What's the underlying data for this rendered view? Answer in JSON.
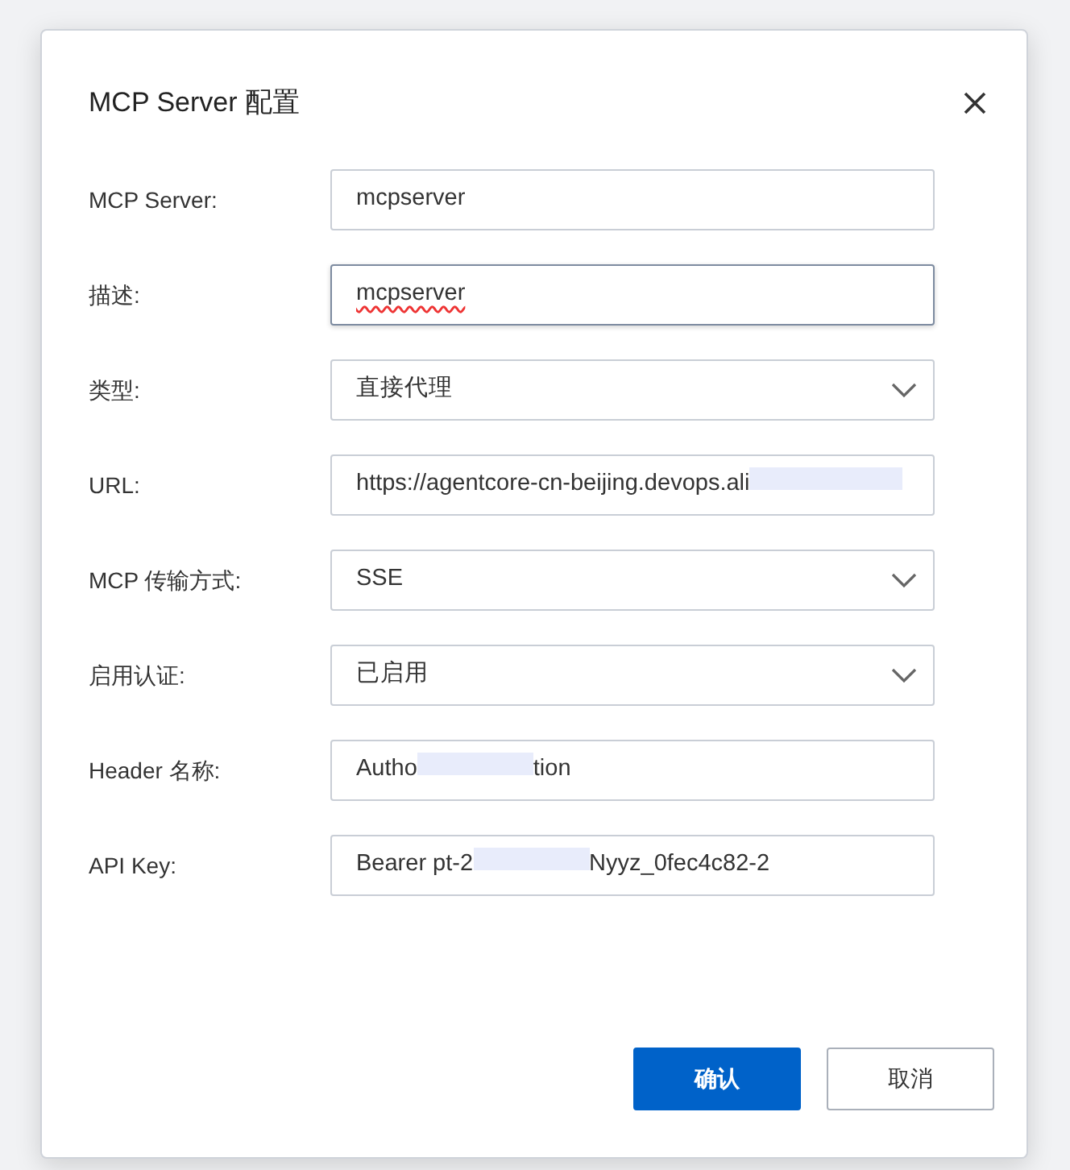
{
  "dialog": {
    "title": "MCP Server 配置",
    "fields": [
      {
        "label": "MCP Server:",
        "kind": "input",
        "value_parts": [
          "mcpserver"
        ],
        "focused": false,
        "misspelled": false
      },
      {
        "label": "描述:",
        "kind": "input",
        "value_parts": [
          "mcpserver"
        ],
        "focused": true,
        "misspelled": true
      },
      {
        "label": "类型:",
        "kind": "select",
        "value_parts": [
          "直接代理"
        ],
        "focused": false,
        "misspelled": false
      },
      {
        "label": "URL:",
        "kind": "input",
        "value_parts": [
          "https://agentcore-cn-beijing.devops.ali"
        ],
        "redacted_tail": true,
        "focused": false,
        "misspelled": false
      },
      {
        "label": "MCP 传输方式:",
        "kind": "select",
        "value_parts": [
          "SSE"
        ],
        "focused": false,
        "misspelled": false
      },
      {
        "label": "启用认证:",
        "kind": "select",
        "value_parts": [
          "已启用"
        ],
        "focused": false,
        "misspelled": false
      },
      {
        "label": "Header 名称:",
        "kind": "input",
        "value_parts": [
          "Autho",
          "tion"
        ],
        "focused": false,
        "misspelled": false
      },
      {
        "label": "API Key:",
        "kind": "input",
        "value_parts": [
          "Bearer pt-2",
          "Nyyz_0fec4c82-2"
        ],
        "focused": false,
        "misspelled": false
      }
    ],
    "buttons": [
      {
        "label": "确认",
        "kind": "primary"
      },
      {
        "label": "取消",
        "kind": "secondary"
      }
    ]
  }
}
